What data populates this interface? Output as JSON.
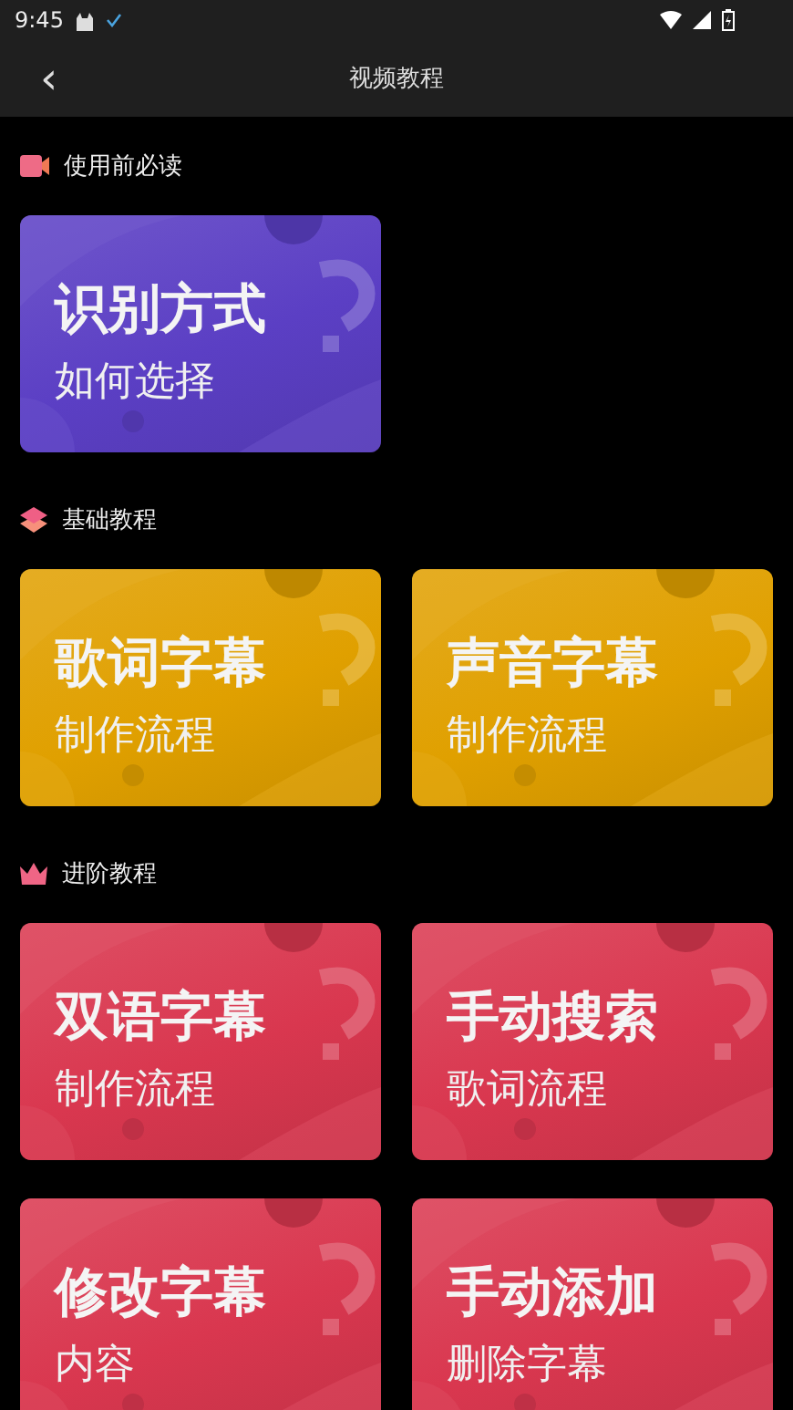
{
  "status_bar": {
    "time": "9:45"
  },
  "header": {
    "back": "‹",
    "title": "视频教程"
  },
  "sections": [
    {
      "title": "使用前必读",
      "kind": "video",
      "color": "#5b3fc4",
      "cards": [
        {
          "title": "识别方式",
          "subtitle": "如何选择"
        }
      ]
    },
    {
      "title": "基础教程",
      "kind": "layers",
      "color": "#e0a000",
      "cards": [
        {
          "title": "歌词字幕",
          "subtitle": "制作流程"
        },
        {
          "title": "声音字幕",
          "subtitle": "制作流程"
        }
      ]
    },
    {
      "title": "进阶教程",
      "kind": "crown",
      "color": "#d9374f",
      "cards": [
        {
          "title": "双语字幕",
          "subtitle": "制作流程"
        },
        {
          "title": "手动搜索",
          "subtitle": "歌词流程"
        },
        {
          "title": "修改字幕",
          "subtitle": "内容"
        },
        {
          "title": "手动添加",
          "subtitle": "删除字幕"
        }
      ]
    }
  ]
}
